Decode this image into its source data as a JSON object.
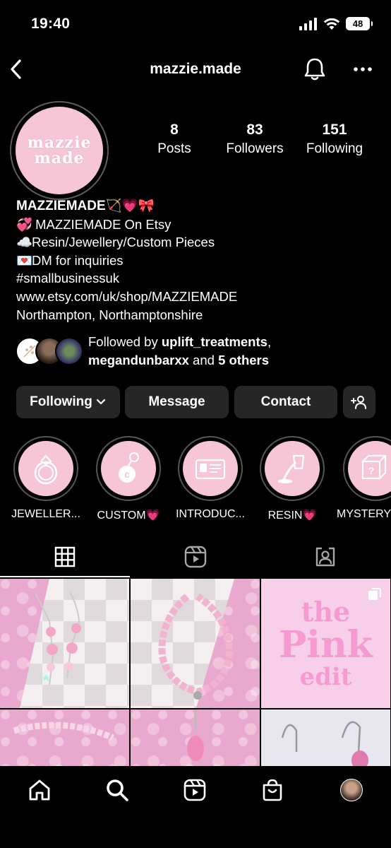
{
  "status_bar": {
    "time": "19:40",
    "battery": "48"
  },
  "header": {
    "username": "mazzie.made"
  },
  "profile": {
    "avatar_text_line1": "mazzie",
    "avatar_text_line2": "made",
    "stats": [
      {
        "value": "8",
        "label": "Posts"
      },
      {
        "value": "83",
        "label": "Followers"
      },
      {
        "value": "151",
        "label": "Following"
      }
    ],
    "bio": {
      "name": "MAZZIEMADE",
      "name_emojis": "🏹💗🎀",
      "lines": [
        {
          "emoji": "💞",
          "text": "MAZZIEMADE On Etsy"
        },
        {
          "emoji": "☁️",
          "text": "Resin/Jewellery/Custom Pieces"
        },
        {
          "emoji": "💌",
          "text": "DM for inquiries"
        },
        {
          "emoji": "",
          "text": "#smallbusinessuk"
        },
        {
          "emoji": "",
          "text": "www.etsy.com/uk/shop/MAZZIEMADE"
        },
        {
          "emoji": "",
          "text": "Northampton, Northamptonshire"
        }
      ]
    },
    "followed_by": {
      "prefix": "Followed by ",
      "user1": "uplift_treatments",
      "sep": ",",
      "user2": "megandunbarxx",
      "and": " and ",
      "others": "5 others"
    }
  },
  "actions": {
    "following": "Following",
    "message": "Message",
    "contact": "Contact"
  },
  "highlights": [
    {
      "label": "JEWELLER...",
      "icon": "ring-icon"
    },
    {
      "label": "CUSTOM💗",
      "icon": "keychain-icon"
    },
    {
      "label": "INTRODUC...",
      "icon": "id-card-icon"
    },
    {
      "label": "RESIN💗",
      "icon": "resin-cup-icon"
    },
    {
      "label": "MYSTERY",
      "icon": "mystery-box-icon"
    }
  ],
  "tabs": [
    "grid-icon",
    "reels-icon",
    "tagged-icon"
  ],
  "posts": [
    {
      "kind": "earrings"
    },
    {
      "kind": "bracelet"
    },
    {
      "kind": "text",
      "line1": "the",
      "line2": "Pink",
      "line3": "edit"
    },
    {
      "kind": "bracelet2"
    },
    {
      "kind": "charm"
    },
    {
      "kind": "earrings2"
    }
  ],
  "bottom_nav": [
    "home-icon",
    "search-icon",
    "reels-icon",
    "shop-icon",
    "profile-icon"
  ],
  "colors": {
    "background": "#000000",
    "button": "#262626",
    "accent_pink": "#f6c6d6"
  }
}
